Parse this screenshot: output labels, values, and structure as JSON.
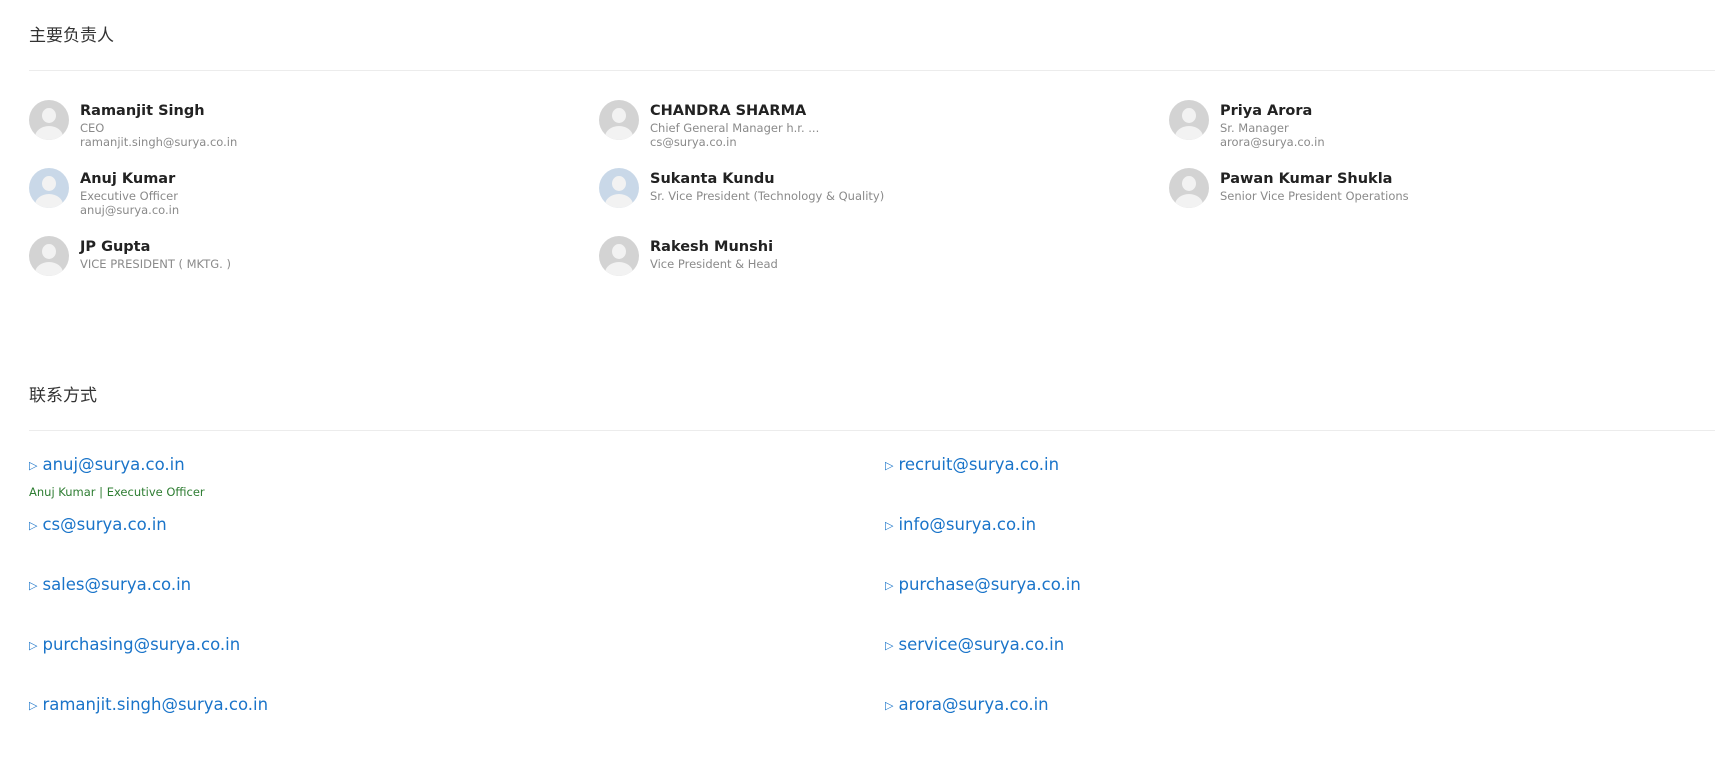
{
  "people_section": {
    "title": "主要负责人"
  },
  "people": [
    {
      "name": "Ramanjit Singh",
      "title": "CEO",
      "email": "ramanjit.singh@surya.co.in"
    },
    {
      "name": "CHANDRA SHARMA",
      "title": "Chief General Manager h.r. ...",
      "email": "cs@surya.co.in"
    },
    {
      "name": "Priya Arora",
      "title": "Sr. Manager",
      "email": "arora@surya.co.in"
    },
    {
      "name": "Anuj Kumar",
      "title": "Executive Officer",
      "email": "anuj@surya.co.in"
    },
    {
      "name": "Sukanta Kundu",
      "title": "Sr. Vice President (Technology & Quality)",
      "email": ""
    },
    {
      "name": "Pawan Kumar Shukla",
      "title": "Senior Vice President Operations",
      "email": ""
    },
    {
      "name": "JP Gupta",
      "title": "VICE PRESIDENT ( MKTG. )",
      "email": ""
    },
    {
      "name": "Rakesh Munshi",
      "title": "Vice President & Head",
      "email": ""
    }
  ],
  "contact_section": {
    "title": "联系方式"
  },
  "contacts": {
    "arrow": "▷",
    "left": [
      {
        "email": "anuj@surya.co.in",
        "note": "Anuj Kumar | Executive Officer"
      },
      {
        "email": "cs@surya.co.in"
      },
      {
        "email": "sales@surya.co.in"
      },
      {
        "email": "purchasing@surya.co.in"
      },
      {
        "email": "ramanjit.singh@surya.co.in"
      }
    ],
    "right": [
      {
        "email": "recruit@surya.co.in"
      },
      {
        "email": "info@surya.co.in"
      },
      {
        "email": "purchase@surya.co.in"
      },
      {
        "email": "service@surya.co.in"
      },
      {
        "email": "arora@surya.co.in"
      }
    ]
  }
}
